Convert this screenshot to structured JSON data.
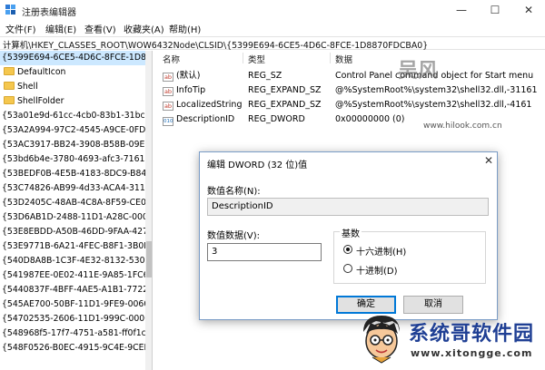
{
  "window": {
    "title": "注册表编辑器",
    "controls": {
      "minimize": "—",
      "maximize": "☐",
      "close": "✕"
    }
  },
  "menu": [
    "文件(F)",
    "编辑(E)",
    "查看(V)",
    "收藏夹(A)",
    "帮助(H)"
  ],
  "address": "计算机\\HKEY_CLASSES_ROOT\\WOW6432Node\\CLSID\\{5399E694-6CE5-4D6C-8FCE-1D8870FDCBA0}",
  "tree": {
    "items": [
      {
        "label": "{5399E694-6CE5-4D6C-8FCE-1D8870FDCBA0}",
        "selected": true,
        "folder": false
      },
      {
        "label": "DefaultIcon",
        "folder": true
      },
      {
        "label": "Shell",
        "folder": true
      },
      {
        "label": "ShellFolder",
        "folder": true
      },
      {
        "label": "{53a01e9d-61cc-4cb0-83b1-31bc"
      },
      {
        "label": "{53A2A994-97C2-4545-A9CE-0FD0"
      },
      {
        "label": "{53AC3917-BB24-3908-B58B-09E0"
      },
      {
        "label": "{53bd6b4e-3780-4693-afc3-7161"
      },
      {
        "label": "{53BEDF0B-4E5B-4183-8DC9-B84"
      },
      {
        "label": "{53C74826-AB99-4d33-ACA4-311"
      },
      {
        "label": "{53D2405C-48AB-4C8A-8F59-CE0"
      },
      {
        "label": "{53D6AB1D-2488-11D1-A28C-000"
      },
      {
        "label": "{53E8EBDD-A50B-46DD-9FAA-427"
      },
      {
        "label": "{53E9771B-6A21-4FEC-B8F1-3B0E"
      },
      {
        "label": "{540D8A8B-1C3F-4E32-8132-530F"
      },
      {
        "label": "{541987EE-0E02-411E-9A85-1FC6"
      },
      {
        "label": "{5440837F-4BFF-4AE5-A1B1-7722"
      },
      {
        "label": "{545AE700-50BF-11D1-9FE9-0060"
      },
      {
        "label": "{54702535-2606-11D1-999C-0000"
      },
      {
        "label": "{548968f5-17f7-4751-a581-ff0f1c"
      },
      {
        "label": "{548F0526-B0EC-4915-9C4E-9CEE"
      }
    ]
  },
  "list": {
    "columns": [
      "名称",
      "类型",
      "数据"
    ],
    "rows": [
      {
        "name": "(默认)",
        "type": "REG_SZ",
        "data": "Control Panel command object for Start menu",
        "icon": "ab"
      },
      {
        "name": "InfoTip",
        "type": "REG_EXPAND_SZ",
        "data": "@%SystemRoot%\\system32\\shell32.dll,-31161",
        "icon": "ab"
      },
      {
        "name": "LocalizedString",
        "type": "REG_EXPAND_SZ",
        "data": "@%SystemRoot%\\system32\\shell32.dll,-4161",
        "icon": "ab"
      },
      {
        "name": "DescriptionID",
        "type": "REG_DWORD",
        "data": "0x00000000 (0)",
        "icon": "010"
      }
    ]
  },
  "watermark": {
    "top": "吴风",
    "url": "www.hilook.com.cn"
  },
  "dialog": {
    "title": "编辑 DWORD (32 位)值",
    "value_name_label": "数值名称(N):",
    "value_name": "DescriptionID",
    "value_data_label": "数值数据(V):",
    "value_data": "3",
    "base_label": "基数",
    "radio_hex": "十六进制(H)",
    "radio_dec": "十进制(D)",
    "selected_base": "hex",
    "ok": "确定",
    "cancel": "取消",
    "close": "✕"
  },
  "brand": {
    "title": "系统哥软件园",
    "url": "www.xitongge.com"
  }
}
